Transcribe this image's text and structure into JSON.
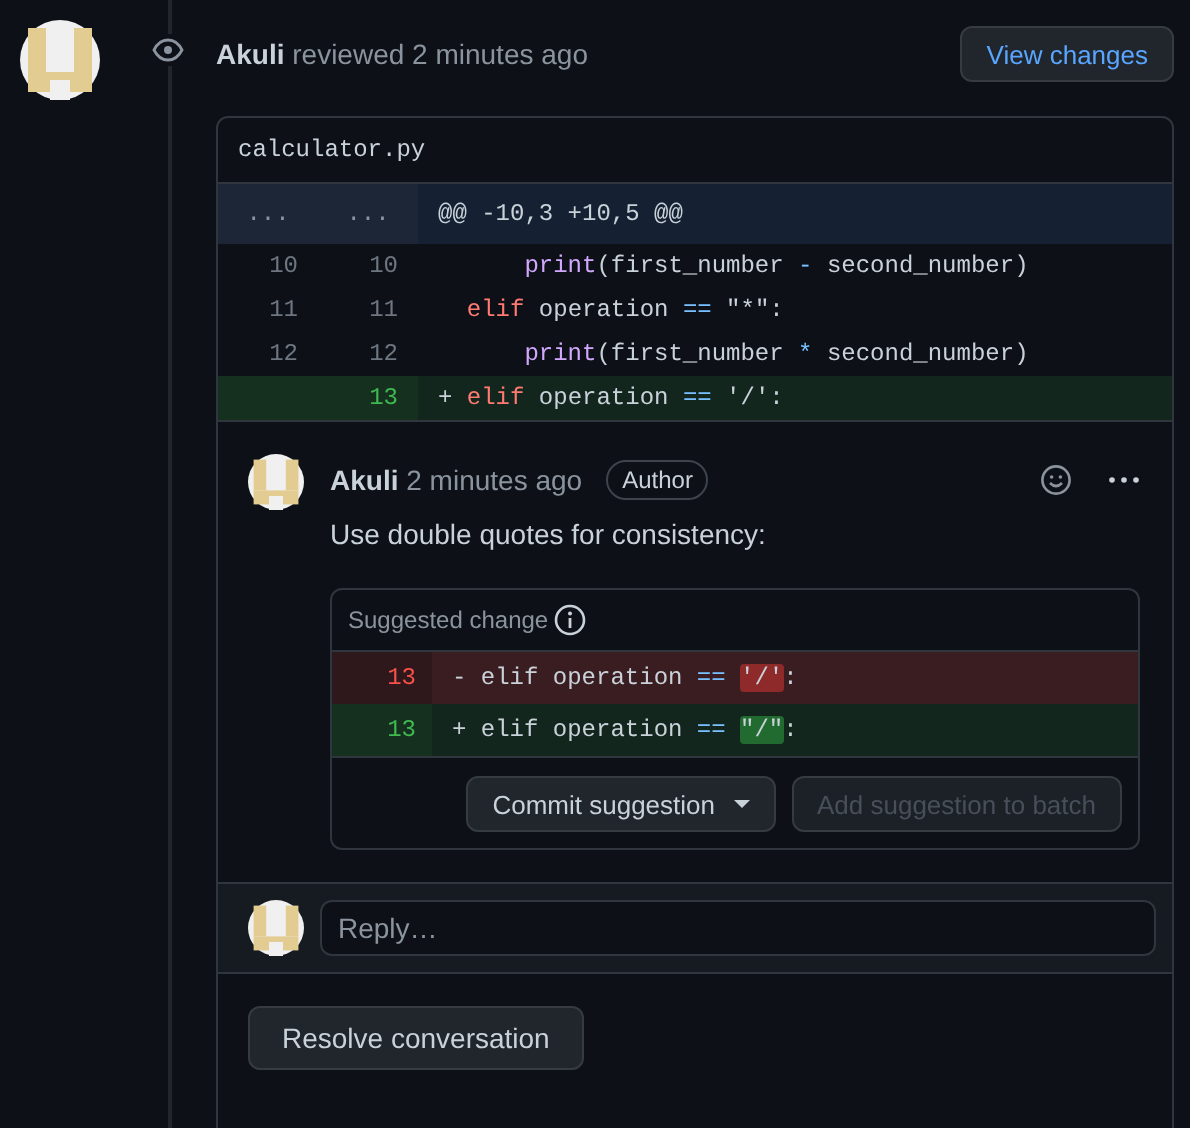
{
  "review": {
    "author": "Akuli",
    "action": "reviewed",
    "time": "2 minutes ago",
    "view_button": "View changes"
  },
  "file": {
    "name": "calculator.py",
    "hunk": {
      "old": "...",
      "new": "...",
      "text": "@@ -10,3 +10,5 @@"
    },
    "lines": [
      {
        "old": "10",
        "new": "10",
        "kind": "context",
        "tokens": [
          {
            "text": "      print",
            "kind": "call"
          },
          {
            "text": "(first_number ",
            "kind": "plain"
          },
          {
            "text": "-",
            "kind": "op"
          },
          {
            "text": " second_number)",
            "kind": "plain"
          }
        ]
      },
      {
        "old": "11",
        "new": "11",
        "kind": "context",
        "tokens": [
          {
            "text": "  elif",
            "kind": "keyword"
          },
          {
            "text": " operation ",
            "kind": "plain"
          },
          {
            "text": "==",
            "kind": "op"
          },
          {
            "text": " \"*\":",
            "kind": "plain"
          }
        ]
      },
      {
        "old": "12",
        "new": "12",
        "kind": "context",
        "tokens": [
          {
            "text": "      print",
            "kind": "call"
          },
          {
            "text": "(first_number ",
            "kind": "plain"
          },
          {
            "text": "*",
            "kind": "op"
          },
          {
            "text": " second_number)",
            "kind": "plain"
          }
        ]
      },
      {
        "new": "13",
        "kind": "added",
        "tokens": [
          {
            "text": "+ ",
            "kind": "plain"
          },
          {
            "text": "elif",
            "kind": "keyword"
          },
          {
            "text": " operation ",
            "kind": "plain"
          },
          {
            "text": "==",
            "kind": "op"
          },
          {
            "text": " '/':",
            "kind": "plain"
          }
        ]
      }
    ]
  },
  "comment": {
    "author": "Akuli",
    "time": "2 minutes ago",
    "badge": "Author",
    "body": "Use double quotes for consistency:",
    "suggestion": {
      "title": "Suggested change",
      "lines": [
        {
          "line": "13",
          "kind": "removed",
          "tokens": [
            {
              "text": "- elif operation ",
              "kind": "plain"
            },
            {
              "text": "== ",
              "kind": "op"
            },
            {
              "text": "'/'",
              "kind": "del-hl"
            },
            {
              "text": ":",
              "kind": "plain"
            }
          ]
        },
        {
          "line": "13",
          "kind": "added",
          "tokens": [
            {
              "text": "+ elif operation ",
              "kind": "plain"
            },
            {
              "text": "== ",
              "kind": "op"
            },
            {
              "text": "\"/\"",
              "kind": "add-hl"
            },
            {
              "text": ":",
              "kind": "plain"
            }
          ]
        }
      ],
      "commit_button": "Commit suggestion",
      "batch_button": {
        "label": "Add suggestion to batch",
        "disabled": true
      }
    }
  },
  "reply": {
    "placeholder": "Reply…"
  },
  "resolve_button": "Resolve conversation"
}
